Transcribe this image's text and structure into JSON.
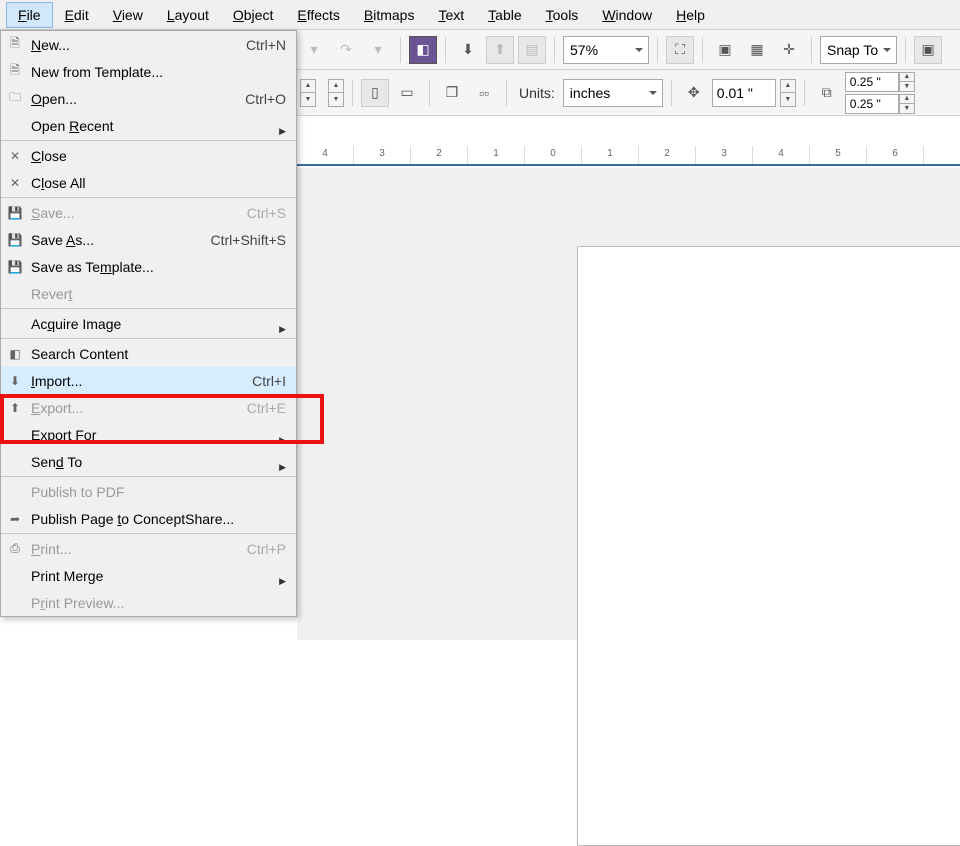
{
  "menubar": {
    "items": [
      {
        "label": "File",
        "ul": "F",
        "active": true
      },
      {
        "label": "Edit",
        "ul": "E"
      },
      {
        "label": "View",
        "ul": "V"
      },
      {
        "label": "Layout",
        "ul": "L"
      },
      {
        "label": "Object",
        "ul": "O"
      },
      {
        "label": "Effects",
        "ul": "E"
      },
      {
        "label": "Bitmaps",
        "ul": "B"
      },
      {
        "label": "Text",
        "ul": "T"
      },
      {
        "label": "Table",
        "ul": "T"
      },
      {
        "label": "Tools",
        "ul": "T"
      },
      {
        "label": "Window",
        "ul": "W"
      },
      {
        "label": "Help",
        "ul": "H"
      }
    ]
  },
  "toolbar1": {
    "zoom_value": "57%",
    "snap_label": "Snap To"
  },
  "toolbar2": {
    "units_label": "Units:",
    "units_value": "inches",
    "nudge_value": "0.01 \"",
    "dup_x": "0.25 \"",
    "dup_y": "0.25 \""
  },
  "ruler": {
    "ticks": [
      "4",
      "3",
      "2",
      "1",
      "0",
      "1",
      "2",
      "3",
      "4",
      "5",
      "6"
    ]
  },
  "file_menu": {
    "groups": [
      [
        {
          "label": "New...",
          "ul": "N",
          "shortcut": "Ctrl+N",
          "icon": "doc"
        },
        {
          "label": "New from Template...",
          "ul": "F",
          "icon": "doc-t"
        },
        {
          "label": "Open...",
          "ul": "O",
          "shortcut": "Ctrl+O",
          "icon": "folder"
        },
        {
          "label": "Open Recent",
          "ul": "R",
          "submenu": true
        }
      ],
      [
        {
          "label": "Close",
          "ul": "C",
          "icon": "close"
        },
        {
          "label": "Close All",
          "ul": "l",
          "icon": "close"
        }
      ],
      [
        {
          "label": "Save...",
          "ul": "S",
          "shortcut": "Ctrl+S",
          "disabled": true,
          "icon": "save"
        },
        {
          "label": "Save As...",
          "ul": "A",
          "shortcut": "Ctrl+Shift+S",
          "icon": "save"
        },
        {
          "label": "Save as Template...",
          "ul": "m",
          "icon": "save"
        },
        {
          "label": "Revert",
          "ul": "t",
          "disabled": true
        }
      ],
      [
        {
          "label": "Acquire Image",
          "ul": "q",
          "submenu": true
        }
      ],
      [
        {
          "label": "Search Content",
          "icon": "search"
        },
        {
          "label": "Import...",
          "ul": "I",
          "shortcut": "Ctrl+I",
          "highlight": true,
          "icon": "import"
        },
        {
          "label": "Export...",
          "ul": "E",
          "shortcut": "Ctrl+E",
          "disabled": true,
          "icon": "export"
        },
        {
          "label": "Export For",
          "ul": "r",
          "submenu": true
        },
        {
          "label": "Send To",
          "ul": "d",
          "submenu": true
        }
      ],
      [
        {
          "label": "Publish to PDF",
          "ul": "H",
          "disabled": true
        },
        {
          "label": "Publish Page to ConceptShare...",
          "ul": "t",
          "icon": "share"
        }
      ],
      [
        {
          "label": "Print...",
          "ul": "P",
          "shortcut": "Ctrl+P",
          "disabled": true,
          "icon": "print"
        },
        {
          "label": "Print Merge",
          "ul": "g",
          "submenu": true
        },
        {
          "label": "Print Preview...",
          "ul": "r",
          "disabled": true
        }
      ]
    ]
  }
}
